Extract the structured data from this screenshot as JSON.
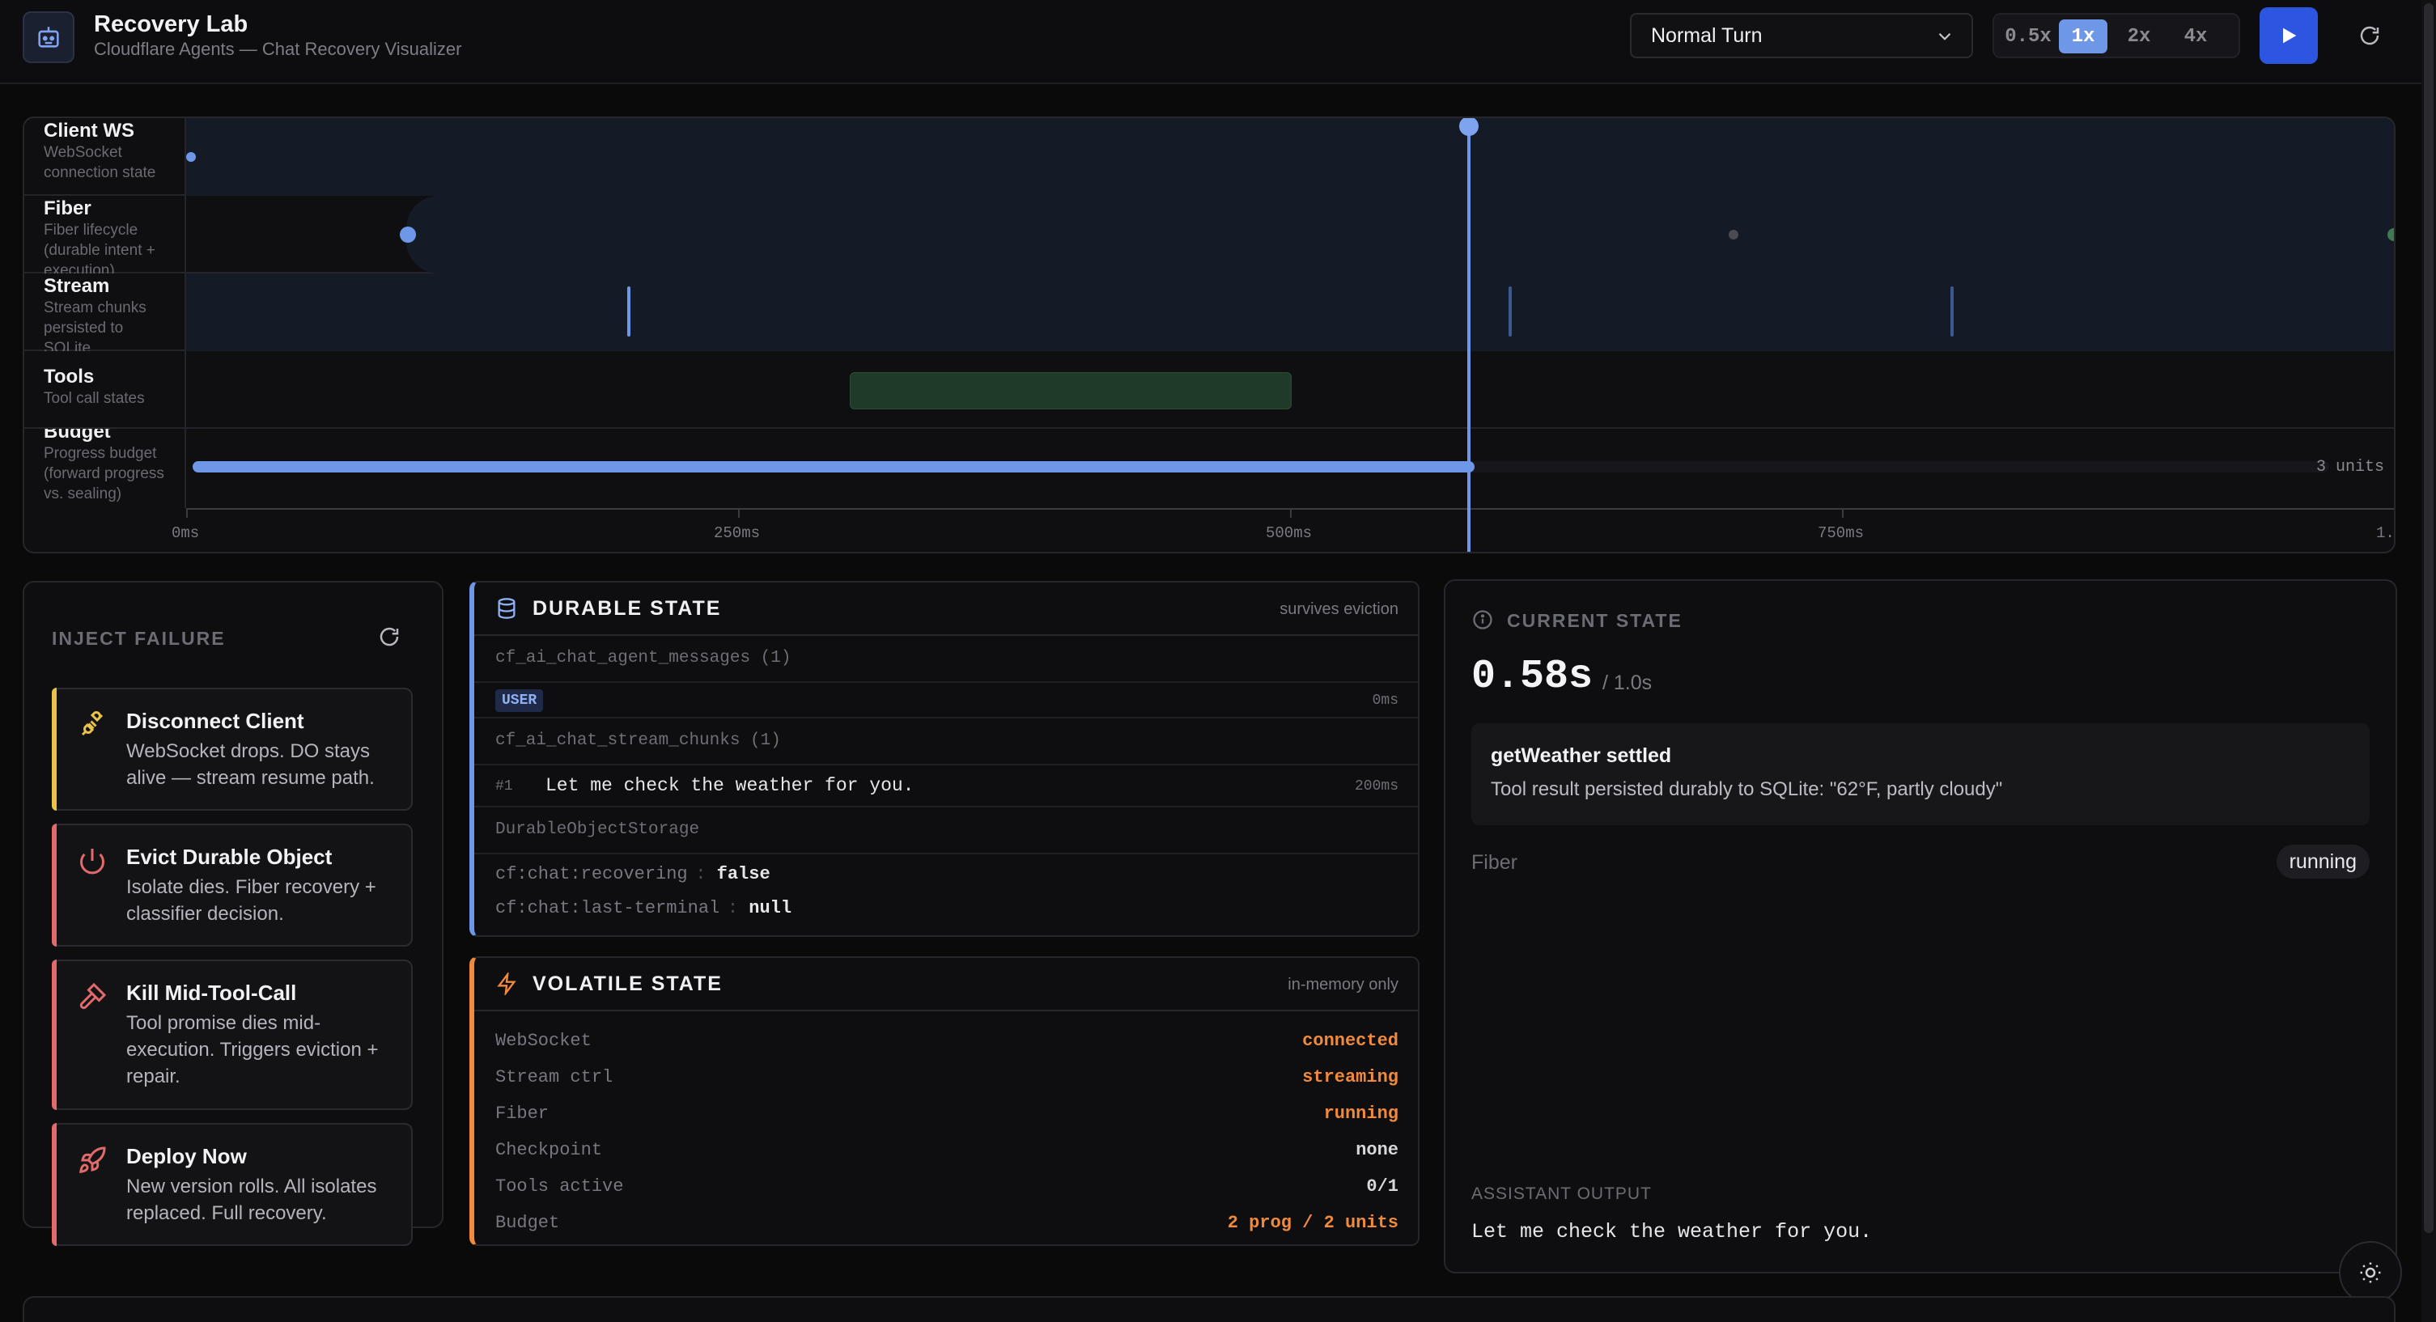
{
  "header": {
    "title": "Recovery Lab",
    "subtitle": "Cloudflare Agents — Chat Recovery Visualizer",
    "scenario": "Normal Turn",
    "speeds": [
      "0.5x",
      "1x",
      "2x",
      "4x"
    ],
    "active_speed": "1x"
  },
  "timeline": {
    "lanes": [
      {
        "name": "Client WS",
        "desc": "WebSocket connection state"
      },
      {
        "name": "Fiber",
        "desc": "Fiber lifecycle (durable intent + execution)"
      },
      {
        "name": "Stream",
        "desc": "Stream chunks persisted to SQLite"
      },
      {
        "name": "Tools",
        "desc": "Tool call states"
      },
      {
        "name": "Budget",
        "desc": "Progress budget (forward progress vs. sealing)"
      }
    ],
    "budget_label": "3 units",
    "ticks": [
      "0ms",
      "250ms",
      "500ms",
      "750ms",
      "1."
    ],
    "playhead_fraction": 0.58,
    "budget_fill_fraction": 0.6
  },
  "inject": {
    "title": "INJECT FAILURE",
    "cards": [
      {
        "title": "Disconnect Client",
        "desc": "WebSocket drops. DO stays alive — stream resume path.",
        "icon": "plug-icon",
        "color": "#e8c24a"
      },
      {
        "title": "Evict Durable Object",
        "desc": "Isolate dies. Fiber recovery + classifier decision.",
        "icon": "power-icon",
        "color": "#e26a6a"
      },
      {
        "title": "Kill Mid-Tool-Call",
        "desc": "Tool promise dies mid-execution. Triggers eviction + repair.",
        "icon": "hammer-icon",
        "color": "#e26a6a"
      },
      {
        "title": "Deploy Now",
        "desc": "New version rolls. All isolates replaced. Full recovery.",
        "icon": "rocket-icon",
        "color": "#e26a6a"
      }
    ]
  },
  "durable": {
    "title": "DURABLE STATE",
    "tag": "survives eviction",
    "messages_table": "cf_ai_chat_agent_messages (1)",
    "message_role": "USER",
    "message_time": "0ms",
    "chunks_table": "cf_ai_chat_stream_chunks (1)",
    "chunk_index": "#1",
    "chunk_text": "Let me check the weather for you.",
    "chunk_time": "200ms",
    "storage_label": "DurableObjectStorage",
    "kv": [
      {
        "key": "cf:chat:recovering",
        "value": "false"
      },
      {
        "key": "cf:chat:last-terminal",
        "value": "null"
      }
    ]
  },
  "volatile": {
    "title": "VOLATILE STATE",
    "tag": "in-memory only",
    "rows": [
      {
        "label": "WebSocket",
        "value": "connected",
        "color": "#f08a3c"
      },
      {
        "label": "Stream ctrl",
        "value": "streaming",
        "color": "#f08a3c"
      },
      {
        "label": "Fiber",
        "value": "running",
        "color": "#f08a3c"
      },
      {
        "label": "Checkpoint",
        "value": "none",
        "color": "#d8d8dc"
      },
      {
        "label": "Tools active",
        "value": "0/1",
        "color": "#d8d8dc"
      },
      {
        "label": "Budget",
        "value": "2 prog / 2 units",
        "color": "#f08a3c"
      }
    ]
  },
  "current": {
    "title": "CURRENT STATE",
    "time": "0.58s",
    "total": "/ 1.0s",
    "event_title": "getWeather settled",
    "event_desc": "Tool result persisted durably to SQLite: \"62°F, partly cloudy\"",
    "fiber_label": "Fiber",
    "fiber_status": "running",
    "output_label": "ASSISTANT OUTPUT",
    "output_text": "Let me check the weather for you."
  }
}
